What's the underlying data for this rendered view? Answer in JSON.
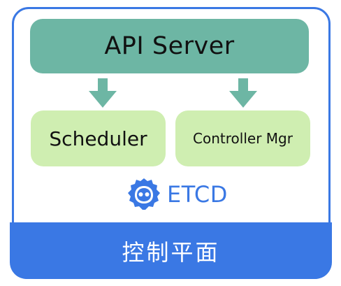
{
  "diagram": {
    "api_server": "API Server",
    "scheduler": "Scheduler",
    "controller_manager": "Controller Mgr",
    "etcd": "ETCD",
    "control_plane": "控制平面"
  },
  "icons": {
    "arrow": "arrow-down-icon",
    "etcd": "etcd-logo-icon"
  },
  "colors": {
    "frame_border": "#3a78e4",
    "api_server_fill": "#6db6a4",
    "component_fill": "#cfeeb1",
    "etcd_text": "#3a78e4",
    "control_plane_fill": "#3a78e4"
  }
}
